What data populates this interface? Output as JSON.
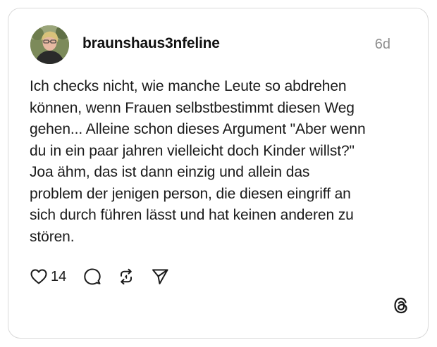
{
  "post": {
    "username": "braunshaus3nfeline",
    "time": "6d",
    "text": "Ich checks nicht, wie manche Leute so abdrehen\nkönnen, wenn Frauen selbstbestimmt diesen Weg\ngehen... Alleine schon dieses Argument \"Aber wenn\ndu in ein paar jahren vielleicht doch Kinder willst?\"\nJoa ähm, das ist dann einzig und allein das\nproblem der jenigen person, die diesen eingriff an\nsich durch führen lässt und hat keinen anderen zu\nstören.",
    "likes": "14"
  },
  "icons": {
    "like": "heart-icon",
    "comment": "comment-icon",
    "repost": "repost-icon",
    "share": "send-icon",
    "brand": "threads-logo-icon"
  },
  "colors": {
    "text": "#1a1a1a",
    "muted": "#8e8e8e",
    "border": "#d9d9d9"
  }
}
